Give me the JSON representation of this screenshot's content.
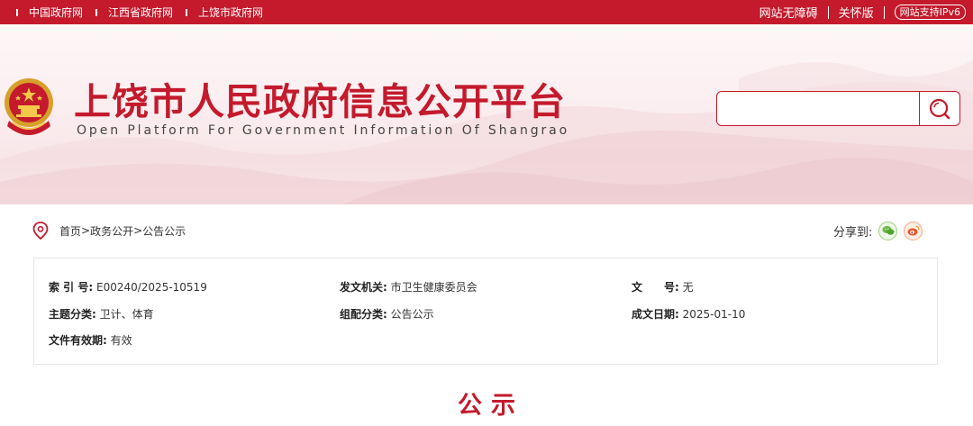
{
  "topbar": {
    "links": [
      "中国政府网",
      "江西省政府网",
      "上饶市政府网"
    ],
    "accessibility": "网站无障碍",
    "elder": "关怀版",
    "ipv6": "网站支持IPv6",
    "color": "#c41a2c"
  },
  "header": {
    "title": "上饶市人民政府信息公开平台",
    "subtitle": "Open Platform For Government Information Of Shangrao",
    "search": {
      "value": "",
      "placeholder": ""
    }
  },
  "breadcrumb": {
    "items": [
      "首页",
      "政务公开",
      "公告公示"
    ],
    "separator": ">"
  },
  "share": {
    "label": "分享到:",
    "icons": [
      "wechat-icon",
      "weibo-icon"
    ]
  },
  "meta": {
    "index_label": "索 引 号:",
    "index_value": "E00240/2025-10519",
    "issuer_label": "发文机关:",
    "issuer_value": "市卫生健康委员会",
    "docno_label": "文　　号:",
    "docno_value": "无",
    "topic_label": "主题分类:",
    "topic_value": "卫计、体育",
    "category_label": "组配分类:",
    "category_value": "公告公示",
    "date_label": "成文日期:",
    "date_value": "2025-01-10",
    "validity_label": "文件有效期:",
    "validity_value": "有效"
  },
  "document": {
    "title": "公示"
  }
}
